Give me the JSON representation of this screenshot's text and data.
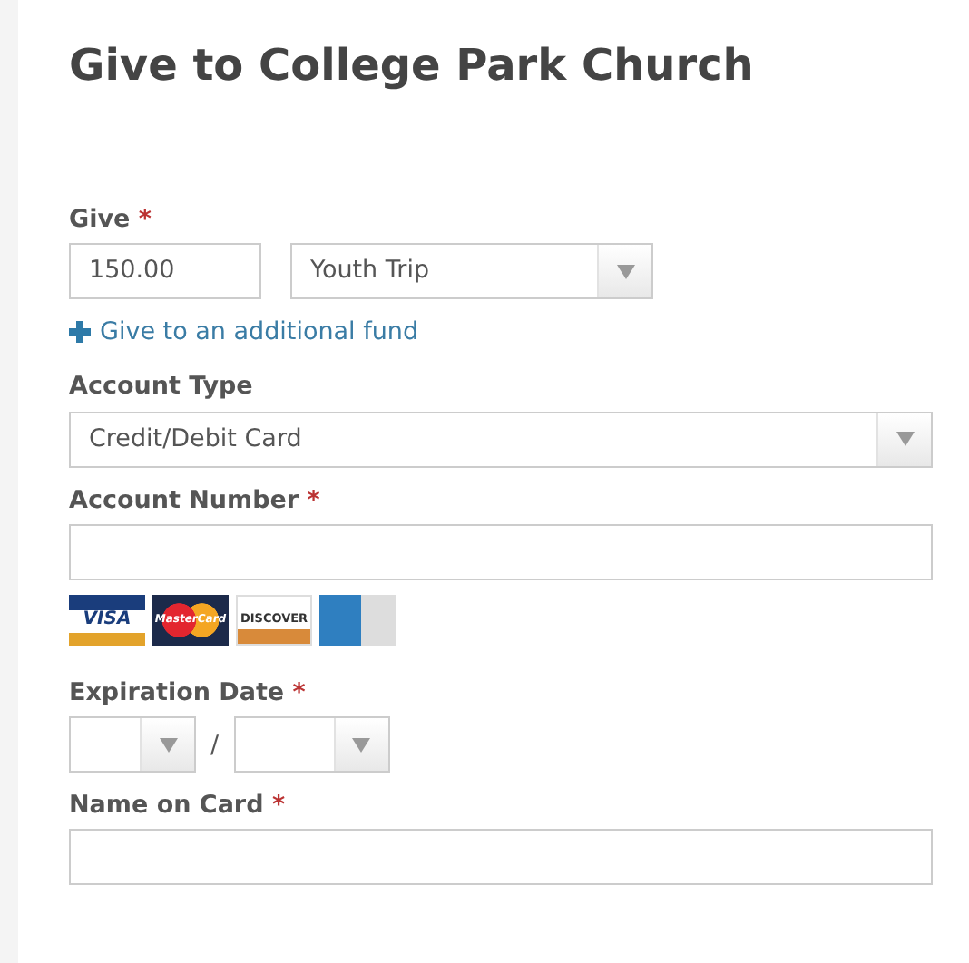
{
  "title": "Give to College Park Church",
  "fields": [
    {
      "kind": "give",
      "label": "Give",
      "required_mark": "*",
      "amount": "150.00",
      "fund": "Youth Trip",
      "link": "Give to an additional fund"
    },
    {
      "kind": "select",
      "label": "Account Type",
      "value": "Credit/Debit Card"
    },
    {
      "kind": "input",
      "label": "Account Number",
      "required_mark": "*",
      "cards": [
        {
          "kind": "visa",
          "label": "VISA"
        },
        {
          "kind": "mastercard",
          "label": "MasterCard"
        },
        {
          "kind": "discover",
          "label": "DISCOVER"
        },
        {
          "kind": "amex"
        }
      ]
    },
    {
      "kind": "expiry",
      "label": "Expiration Date",
      "required_mark": "*",
      "separator": "/"
    },
    {
      "kind": "input",
      "label": "Name on Card",
      "required_mark": "*"
    }
  ]
}
